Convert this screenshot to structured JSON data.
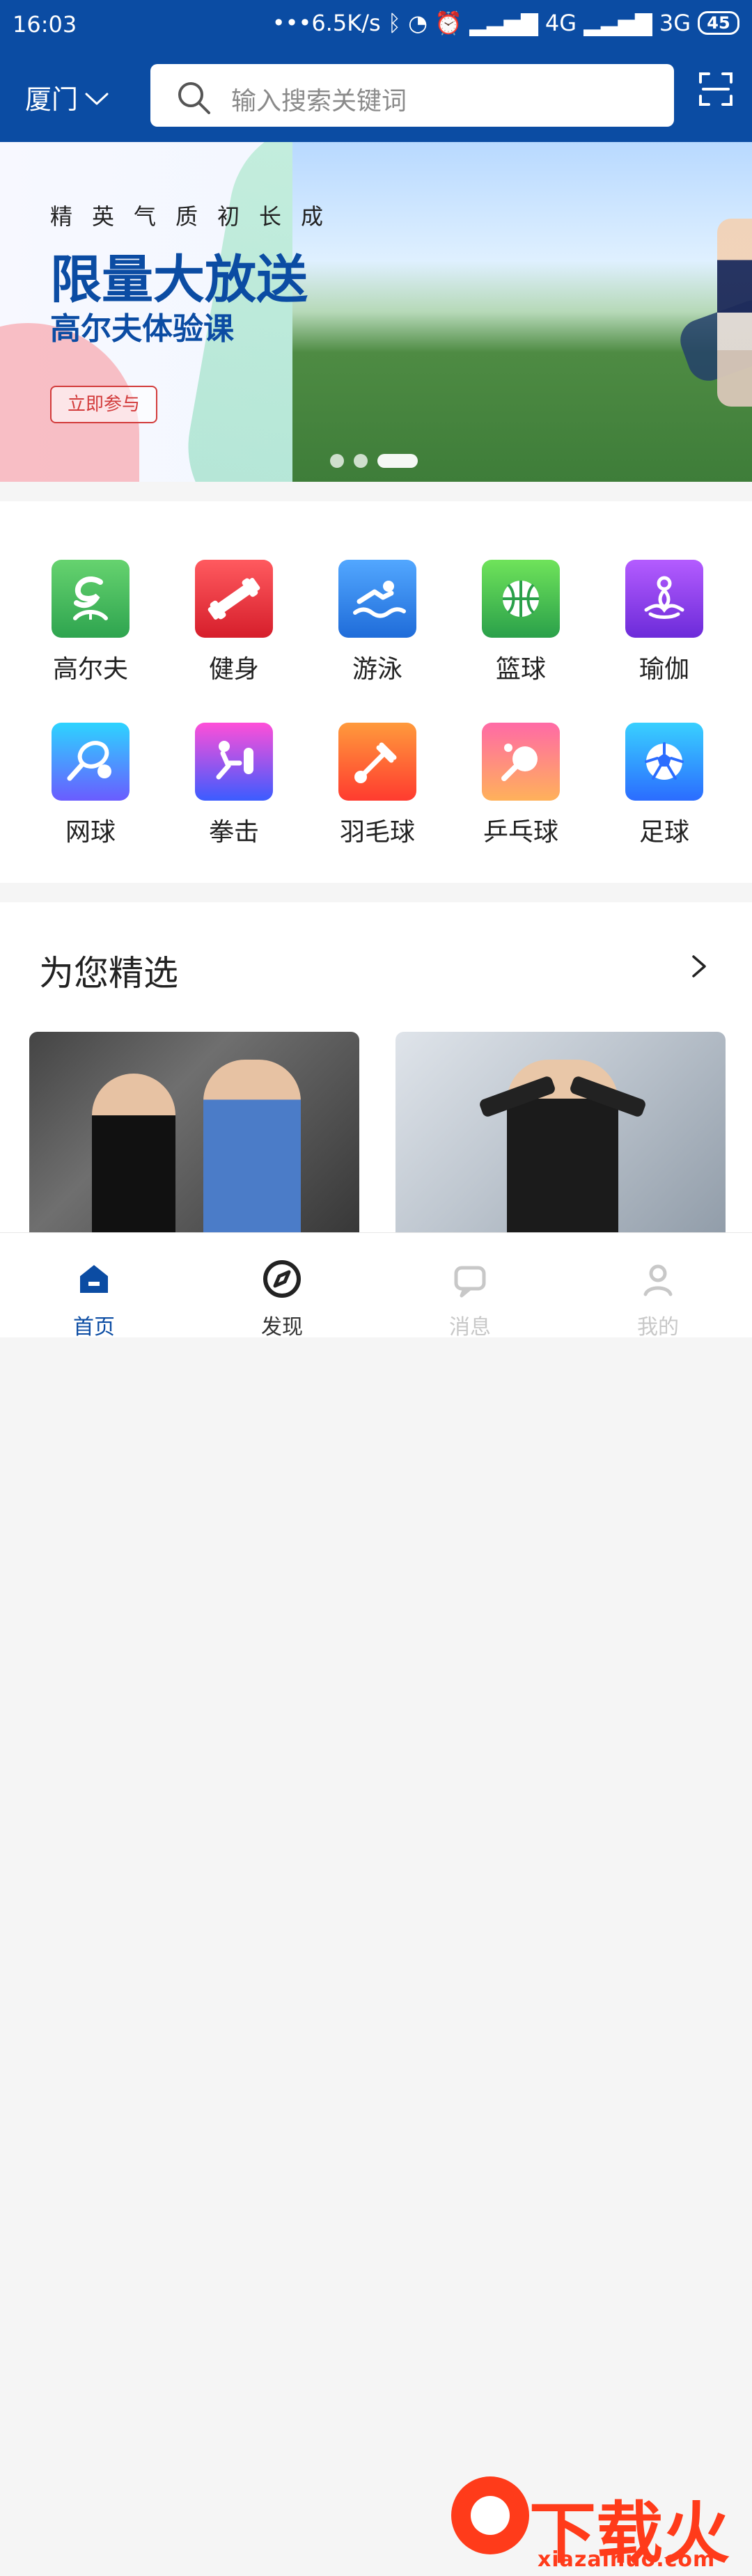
{
  "status": {
    "time": "16:03",
    "indicators": "•••6.5K/s  ᛒ  ◔  ⏰  ▂▃▅▇ 4G  ▂▃▅▇ 3G",
    "battery": "45"
  },
  "header": {
    "city": "厦门",
    "search_placeholder": "输入搜索关键词"
  },
  "banner": {
    "tagline": "精英气质初长成",
    "headline1": "限量大放送",
    "headline2": "高尔夫体验课",
    "cta": "立即参与",
    "dots": {
      "count": 3,
      "active_index": 2
    }
  },
  "categories": [
    {
      "label": "高尔夫",
      "icon": "golf-icon",
      "color_from": "#66d36f",
      "color_to": "#2ea44f"
    },
    {
      "label": "健身",
      "icon": "dumbbell-icon",
      "color_from": "#ff5a5f",
      "color_to": "#d61e2b"
    },
    {
      "label": "游泳",
      "icon": "swim-icon",
      "color_from": "#52a7ff",
      "color_to": "#1f6cd9"
    },
    {
      "label": "篮球",
      "icon": "basketball-icon",
      "color_from": "#6fe35a",
      "color_to": "#2aa04a"
    },
    {
      "label": "瑜伽",
      "icon": "yoga-icon",
      "color_from": "#b45cff",
      "color_to": "#6c2bd9"
    },
    {
      "label": "网球",
      "icon": "tennis-icon",
      "color_from": "#2dd4ff",
      "color_to": "#6a5cff"
    },
    {
      "label": "拳击",
      "icon": "boxing-icon",
      "color_from": "#ff4fd8",
      "color_to": "#3b5cff"
    },
    {
      "label": "羽毛球",
      "icon": "badminton-icon",
      "color_from": "#ff9a3c",
      "color_to": "#ff3b2f"
    },
    {
      "label": "乒乓球",
      "icon": "pingpong-icon",
      "color_from": "#ff6aa6",
      "color_to": "#ffb15a"
    },
    {
      "label": "足球",
      "icon": "soccer-icon",
      "color_from": "#39d0ff",
      "color_to": "#2b6cff"
    }
  ],
  "featured": {
    "title": "为您精选"
  },
  "tabs": [
    {
      "label": "首页",
      "icon": "home-icon",
      "active": true,
      "faded": false
    },
    {
      "label": "发现",
      "icon": "discover-icon",
      "active": false,
      "faded": false
    },
    {
      "label": "消息",
      "icon": "message-icon",
      "active": false,
      "faded": true
    },
    {
      "label": "我的",
      "icon": "profile-icon",
      "active": false,
      "faded": true
    }
  ],
  "watermark": {
    "text": "下载火",
    "url": "xiazaihuo.com"
  }
}
